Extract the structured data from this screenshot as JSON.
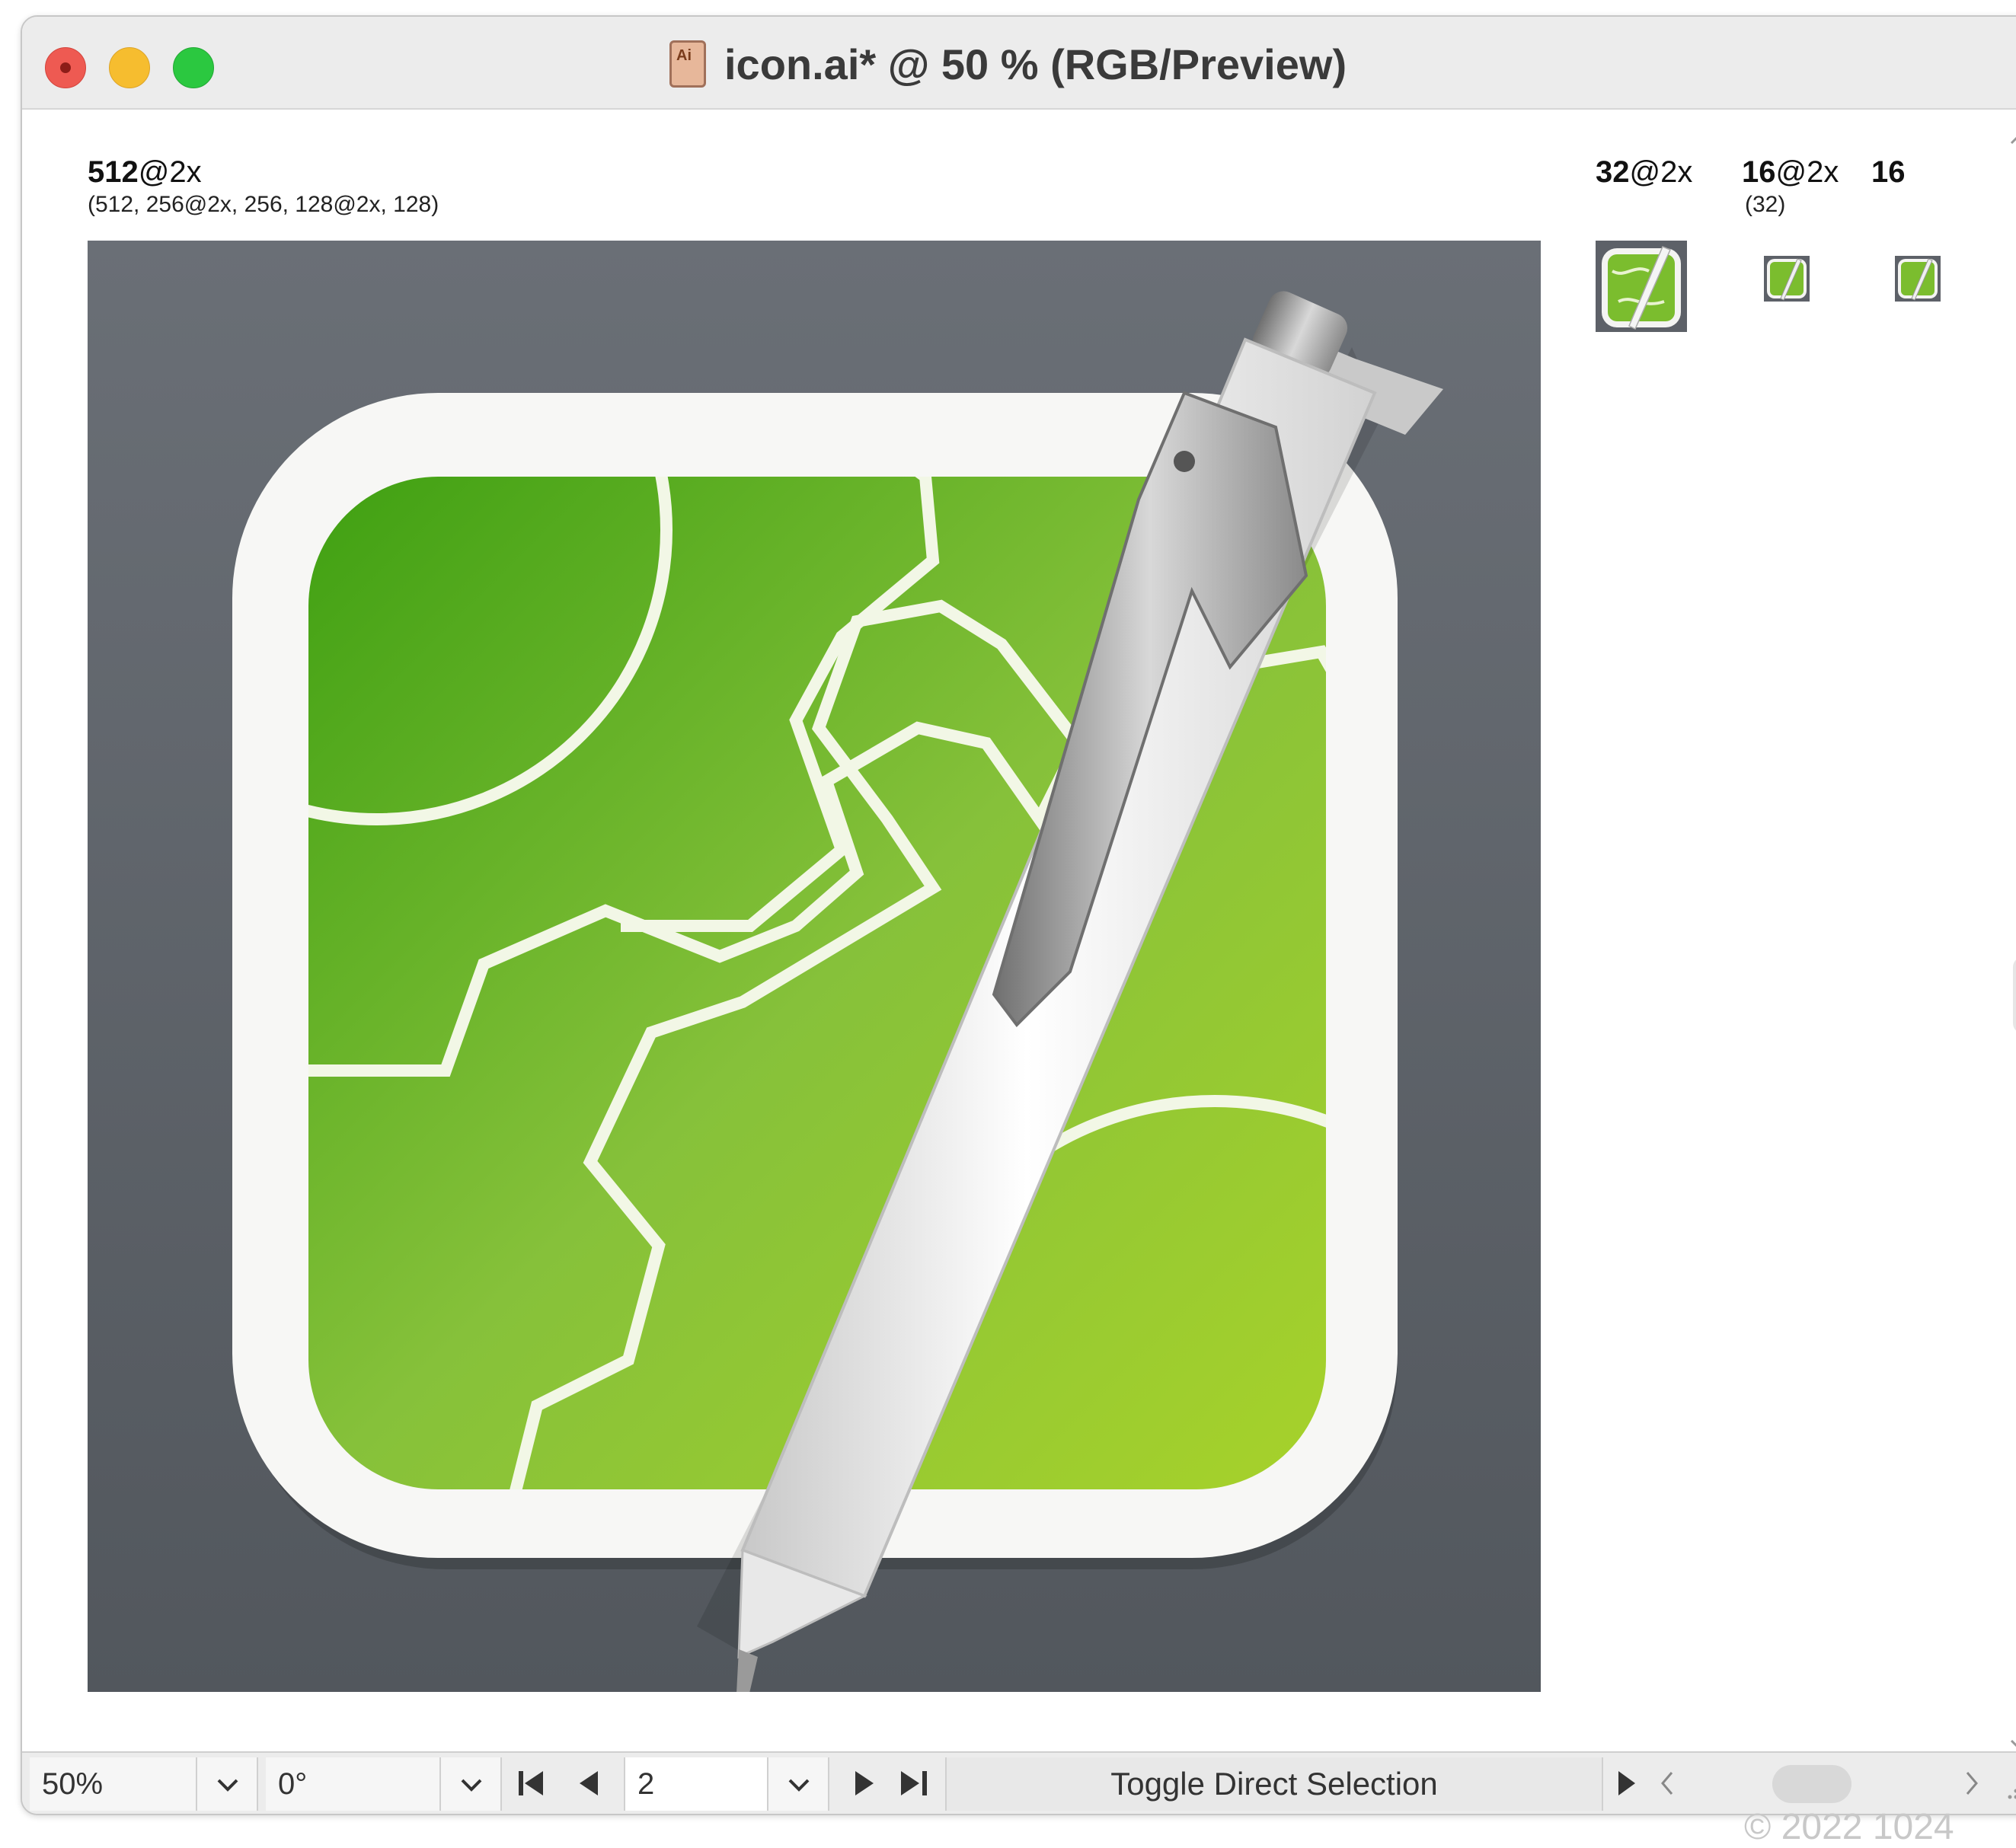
{
  "window": {
    "title": "icon.ai* @ 50 % (RGB/Preview)",
    "doc_icon_label": "Ai",
    "traffic_lights": [
      "close",
      "minimize",
      "zoom"
    ]
  },
  "artboards": {
    "main": {
      "size": "512",
      "scale": "@2x",
      "subtitle": "(512, 256@2x, 256, 128@2x, 128)"
    },
    "small": [
      {
        "size": "32",
        "scale": "@2x",
        "subtitle": ""
      },
      {
        "size": "16",
        "scale": "@2x",
        "subtitle": "(32)"
      },
      {
        "size": "16",
        "scale": "",
        "subtitle": ""
      }
    ]
  },
  "bottombar": {
    "zoom": "50%",
    "rotation": "0°",
    "artboard_number": "2",
    "status": "Toggle Direct Selection"
  },
  "watermark": "© 2022 1024",
  "colors": {
    "artboard_bg_top": "#6a6f76",
    "artboard_bg_bottom": "#52575d",
    "green_light": "#a7d22a",
    "green_dark": "#3fa012",
    "close": "#ee5a52",
    "minimize": "#f6bd2f",
    "zoom": "#2bc840"
  }
}
